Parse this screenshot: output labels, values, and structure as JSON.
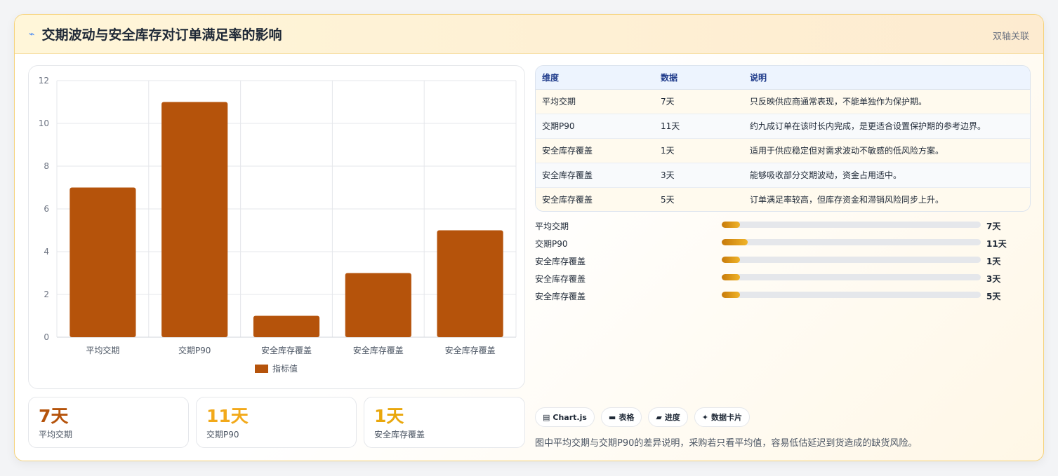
{
  "header": {
    "icon": "trend-icon",
    "title": "交期波动与安全库存对订单满足率的影响",
    "link": "双轴关联"
  },
  "chart_data": {
    "type": "bar",
    "categories": [
      "平均交期",
      "交期P90",
      "安全库存覆盖",
      "安全库存覆盖",
      "安全库存覆盖"
    ],
    "series": [
      {
        "name": "指标值",
        "values": [
          7,
          11,
          1,
          3,
          5
        ],
        "color": "#b5530b"
      }
    ],
    "ylim": [
      0,
      12
    ],
    "yticks": [
      0,
      2,
      4,
      6,
      8,
      10,
      12
    ],
    "grid": true,
    "legend": "bottom"
  },
  "stats": [
    {
      "value": "7天",
      "label": "平均交期",
      "color": "#b5530b"
    },
    {
      "value": "11天",
      "label": "交期P90",
      "color": "#f2a91a"
    },
    {
      "value": "1天",
      "label": "安全库存覆盖",
      "color": "#e9a70c"
    }
  ],
  "table": {
    "headers": [
      "维度",
      "数据",
      "说明"
    ],
    "rows": [
      [
        "平均交期",
        "7天",
        "只反映供应商通常表现，不能单独作为保护期。"
      ],
      [
        "交期P90",
        "11天",
        "约九成订单在该时长内完成，是更适合设置保护期的参考边界。"
      ],
      [
        "安全库存覆盖",
        "1天",
        "适用于供应稳定但对需求波动不敏感的低风险方案。"
      ],
      [
        "安全库存覆盖",
        "3天",
        "能够吸收部分交期波动，资金占用适中。"
      ],
      [
        "安全库存覆盖",
        "5天",
        "订单满足率较高，但库存资金和滞销风险同步上升。"
      ]
    ]
  },
  "progress": [
    {
      "label": "平均交期",
      "value": "7天",
      "fill": 0.07
    },
    {
      "label": "交期P90",
      "value": "11天",
      "fill": 0.1
    },
    {
      "label": "安全库存覆盖",
      "value": "1天",
      "fill": 0.07
    },
    {
      "label": "安全库存覆盖",
      "value": "3天",
      "fill": 0.07
    },
    {
      "label": "安全库存覆盖",
      "value": "5天",
      "fill": 0.07
    }
  ],
  "chips": [
    {
      "icon": "chart-icon",
      "glyph": "▤",
      "label": "Chart.js"
    },
    {
      "icon": "table-icon",
      "glyph": "▬",
      "label": "表格"
    },
    {
      "icon": "progress-icon",
      "glyph": "▰",
      "label": "进度"
    },
    {
      "icon": "sparkle-icon",
      "glyph": "✦",
      "label": "数据卡片"
    }
  ],
  "note": "图中平均交期与交期P90的差异说明，采购若只看平均值，容易低估延迟到货造成的缺货风险。"
}
